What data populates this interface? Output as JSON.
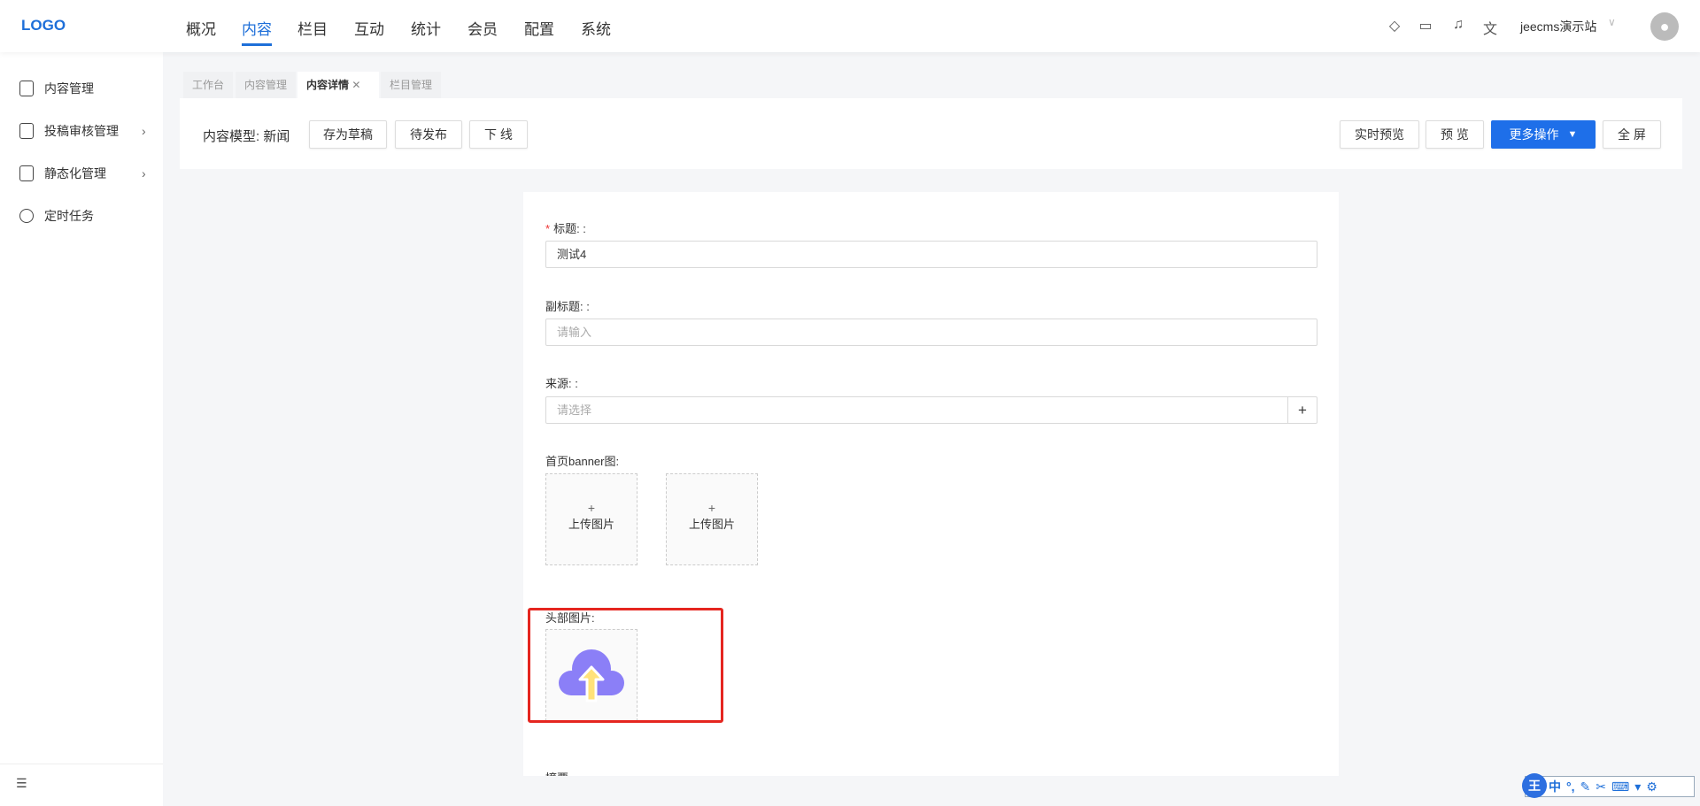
{
  "header": {
    "logo": "LOGO",
    "nav": [
      "概况",
      "内容",
      "栏目",
      "互动",
      "统计",
      "会员",
      "配置",
      "系统"
    ],
    "active_nav": "内容",
    "site": "jeecms演示站"
  },
  "sidebar": {
    "items": [
      {
        "label": "内容管理"
      },
      {
        "label": "投稿审核管理"
      },
      {
        "label": "静态化管理"
      },
      {
        "label": "定时任务"
      }
    ]
  },
  "tabs": [
    {
      "label": "工作台"
    },
    {
      "label": "内容管理"
    },
    {
      "label": "内容详情"
    },
    {
      "label": "栏目管理"
    }
  ],
  "toolbar": {
    "model_label": "内容模型:",
    "model_value": "新闻",
    "save_draft": "存为草稿",
    "pending": "待发布",
    "offline": "下 线",
    "live_preview": "实时预览",
    "preview": "预 览",
    "more": "更多操作",
    "fullscreen": "全 屏"
  },
  "form": {
    "title_label": "标题: :",
    "title_value": "测试4",
    "subtitle_label": "副标题: :",
    "subtitle_placeholder": "请输入",
    "source_label": "来源: :",
    "source_placeholder": "请选择",
    "add": "+",
    "banner_label": "首页banner图:",
    "upload_plus": "+",
    "upload_text": "上传图片",
    "header_image_label": "头部图片:",
    "summary_label": "摘要"
  },
  "ime": {
    "logo": "王",
    "items": [
      "中",
      "°,"
    ]
  },
  "colors": {
    "accent": "#1e6fd9",
    "highlight": "#e52620"
  }
}
